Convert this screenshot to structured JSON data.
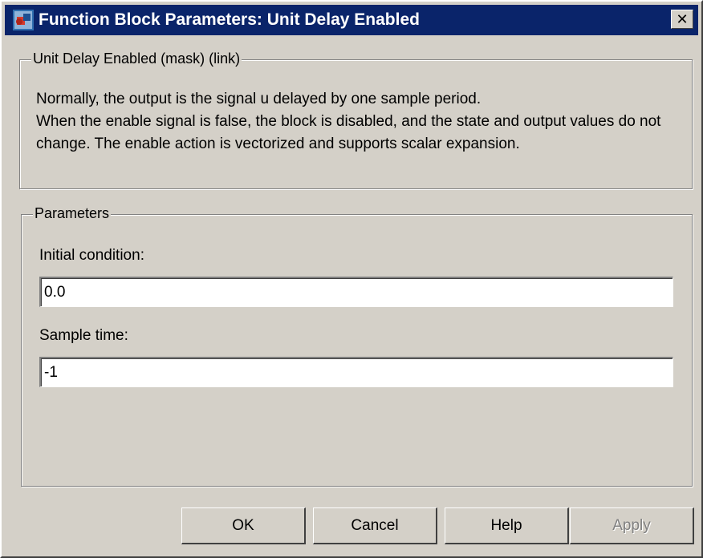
{
  "window": {
    "title": "Function Block Parameters: Unit Delay Enabled",
    "close_glyph": "✕",
    "icon": "simulink-block-icon"
  },
  "description_group": {
    "legend": "Unit Delay Enabled (mask) (link)",
    "lines": [
      "Normally, the output is the signal u delayed by one sample period.",
      "When the enable signal is false, the block is disabled, and the state and output values do not change.  The enable action is vectorized and supports scalar expansion."
    ]
  },
  "parameters_group": {
    "legend": "Parameters",
    "initial_condition": {
      "label": "Initial condition:",
      "value": "0.0"
    },
    "sample_time": {
      "label": "Sample time:",
      "value": "-1"
    }
  },
  "buttons": {
    "ok": "OK",
    "cancel": "Cancel",
    "help": "Help",
    "apply": "Apply"
  },
  "colors": {
    "titlebar": "#0a246a",
    "face": "#d4d0c8",
    "disabled_text": "#808080"
  }
}
